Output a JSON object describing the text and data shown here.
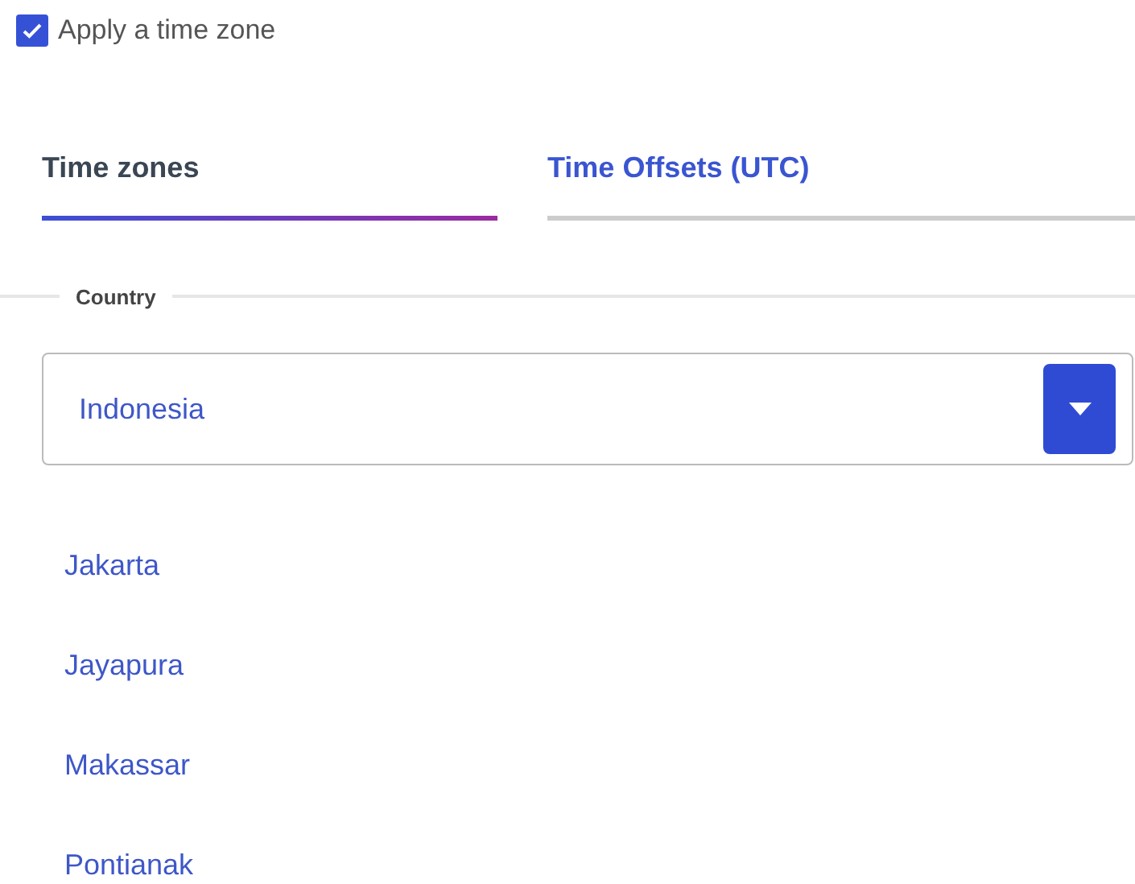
{
  "apply_time_zone": {
    "label": "Apply a time zone",
    "checked": true
  },
  "tabs": [
    {
      "label": "Time zones",
      "selected": true
    },
    {
      "label": "Time Offsets (UTC)",
      "selected": false
    }
  ],
  "country": {
    "legend": "Country",
    "value": "Indonesia"
  },
  "time_zones": [
    {
      "label": "Jakarta"
    },
    {
      "label": "Jayapura"
    },
    {
      "label": "Makassar"
    },
    {
      "label": "Pontianak"
    }
  ]
}
